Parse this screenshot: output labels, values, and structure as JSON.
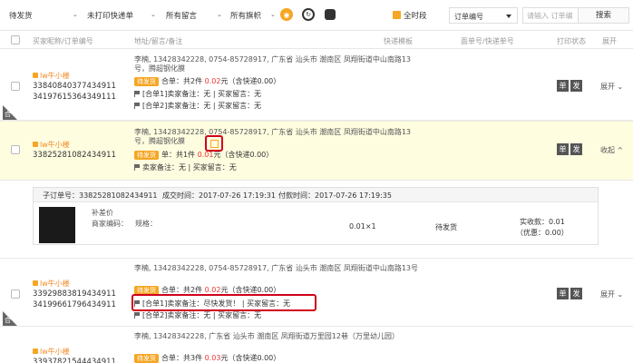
{
  "filters": {
    "status": "待发货",
    "express": "未打印快递单",
    "message": "所有留言",
    "flag": "所有旗帜",
    "time_label": "全时段",
    "search_field": "订单编号",
    "search_placeholder": "请输入 订单编",
    "search_button": "搜索"
  },
  "header": {
    "buyer_col": "买家昵称/订单编号",
    "address_col": "地址/留言/备注",
    "express_col": "快递模板",
    "waybill_col": "面单号/快递单号",
    "print_col": "打印状态",
    "expand_col": "展开"
  },
  "orders": [
    {
      "buyer": "lw牛小楼",
      "ids": [
        "33840840377434911",
        "34197615364349111"
      ],
      "address": "李楠, 13428342228, 0754-85728917, 广东省 汕头市 潮南区 凤翔街道中山南路13号，腾超钢化膜",
      "status": "待发货",
      "summary_a": "合单：共2件 ",
      "price": "0.02",
      "summary_b": "元（含快递0.00）",
      "note1": "[合单1]卖家备注：无 | 买家留言：无",
      "note2": "[合单2]卖家备注：无 | 买家留言：无",
      "print_a": "单",
      "print_b": "发",
      "expand": "展开"
    },
    {
      "buyer": "lw牛小楼",
      "ids": [
        "33825281082434911"
      ],
      "address": "李楠, 13428342228, 0754-85728917, 广东省 汕头市 潮南区 凤翔街道中山南路13号，腾超钢化膜",
      "status": "待发货",
      "summary_a": "单：共1件 ",
      "price": "0.01",
      "summary_b": "元（含快递0.00）",
      "note1": "卖家备注：无 | 买家留言：无",
      "print_a": "单",
      "print_b": "发",
      "expand": "收起"
    },
    {
      "buyer": "lw牛小楼",
      "ids": [
        "33929883819434911",
        "34199661796434911"
      ],
      "address": "李楠, 13428342228, 0754-85728917, 广东省 汕头市 潮南区 凤翔街道中山南路13号",
      "status": "待发货",
      "summary_a": "合单：共2件 ",
      "price": "0.02",
      "summary_b": "元（含快递0.00）",
      "note1": "[合单1]卖家备注：尽快发货！ | 买家留言：无",
      "note2": "[合单2]卖家备注：无 | 买家留言：无",
      "print_a": "单",
      "print_b": "发",
      "expand": "展开"
    },
    {
      "buyer": "lw牛小楼",
      "ids": [
        "33937821544434911"
      ],
      "address": "李楠, 13428342228, 广东省 汕头市 潮南区 凤翔街道万里园12巷（万里幼儿园）",
      "status": "待发货",
      "summary_a": "合单：共3件 ",
      "price": "0.03",
      "summary_b": "元（含快递0.00）"
    }
  ],
  "sub_order": {
    "order_id": "子订单号：33825281082434911",
    "created": "成交时间：2017-07-26 17:19:31",
    "paid": "付款时间：2017-07-26 17:19:35",
    "product": "补差价",
    "code": "商家编码：",
    "spec": "规格：",
    "qty": "0.01×1",
    "status": "待发货",
    "received": "实收款：0.01",
    "discount": "（优惠：0.00）"
  },
  "corner_label": "合",
  "colors": {
    "accent": "#f5a623",
    "price": "#e33333",
    "annotation": "#d0021b",
    "highlight": "#fffde0"
  }
}
